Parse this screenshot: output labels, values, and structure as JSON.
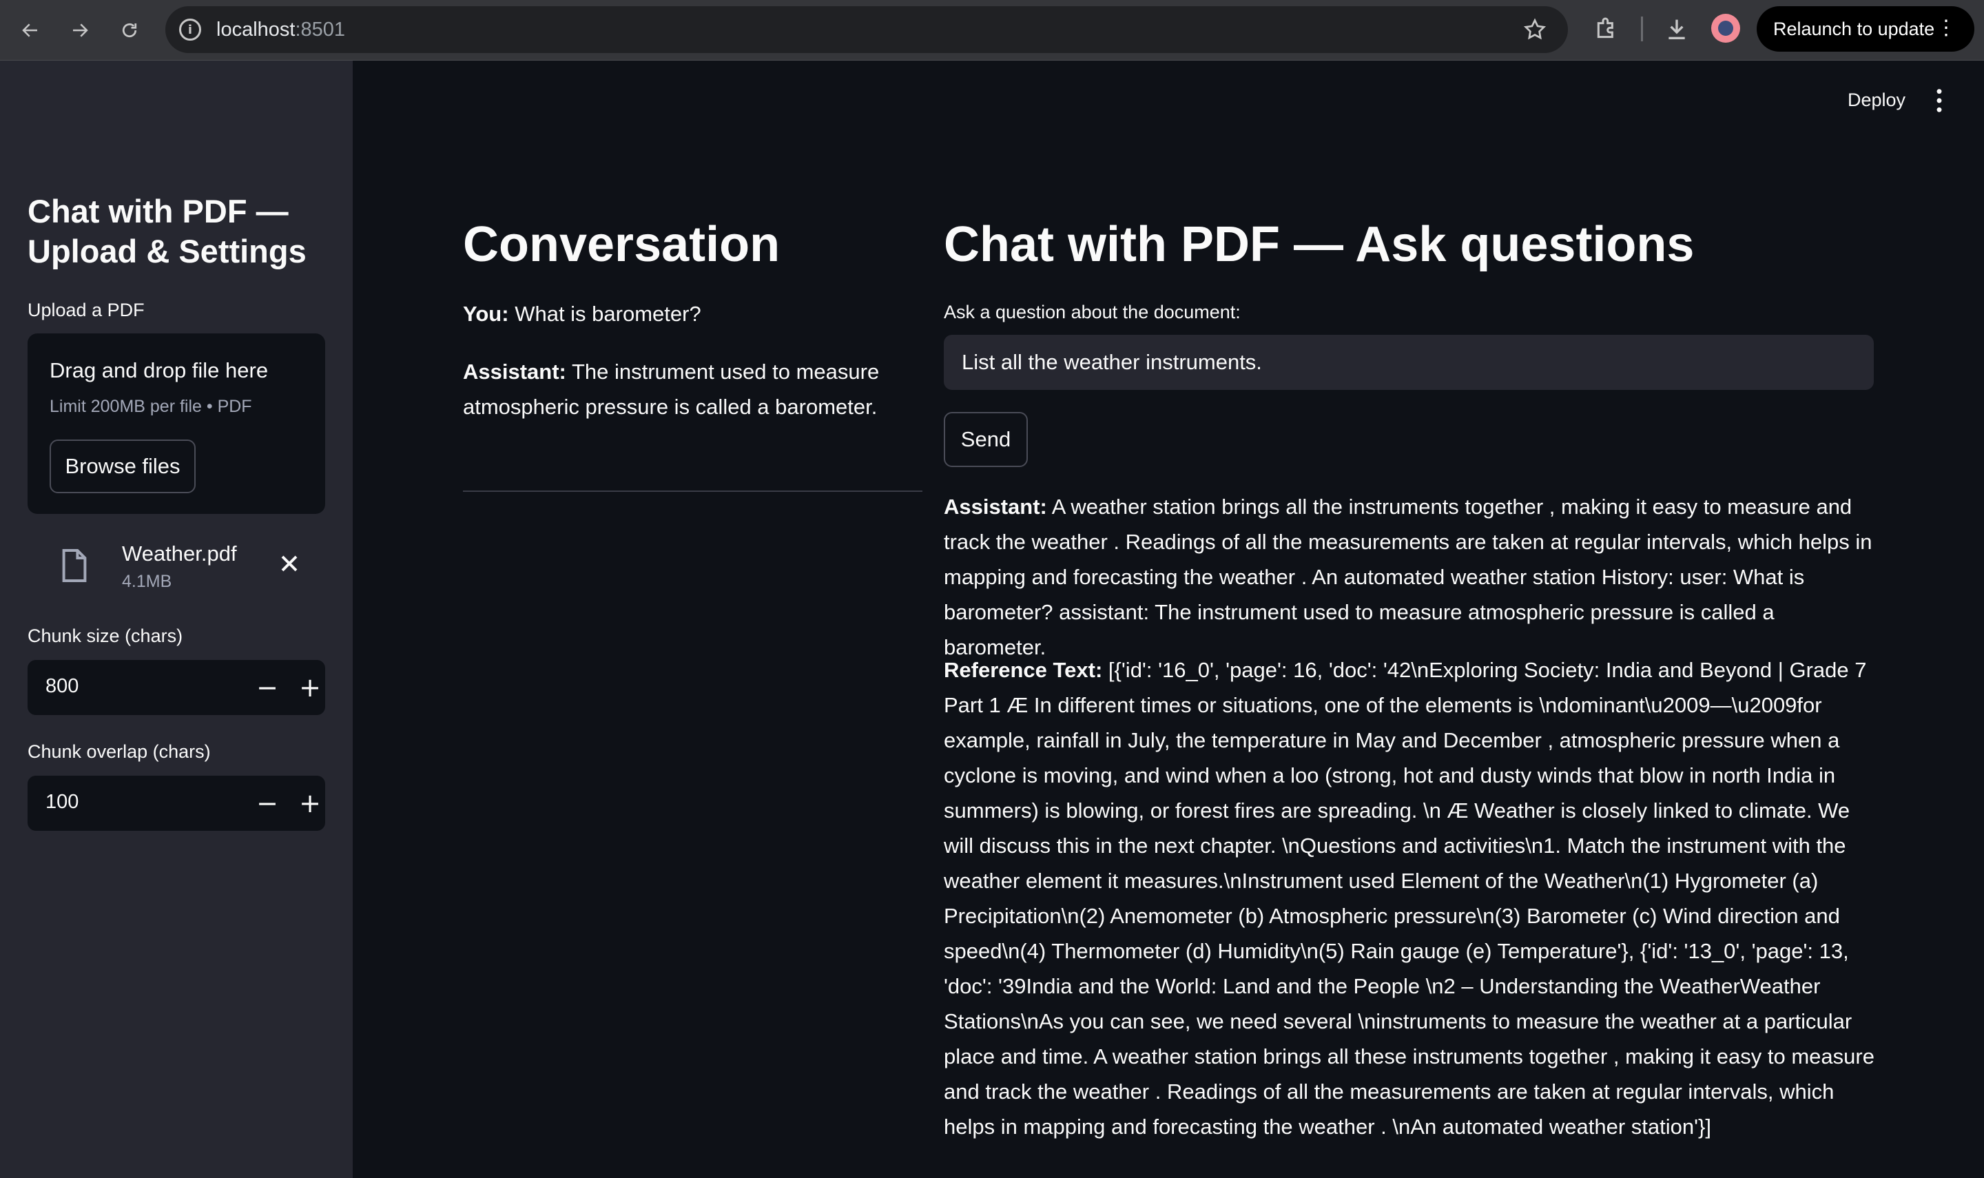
{
  "browser": {
    "url_host": "localhost",
    "url_port": ":8501",
    "relaunch_label": "Relaunch to update"
  },
  "sidebar": {
    "title": "Chat with PDF — Upload & Settings",
    "upload_label": "Upload a PDF",
    "dropzone": {
      "title": "Drag and drop file here",
      "subtitle": "Limit 200MB per file • PDF",
      "browse_label": "Browse files"
    },
    "file": {
      "name": "Weather.pdf",
      "size": "4.1MB"
    },
    "chunk_size": {
      "label": "Chunk size (chars)",
      "value": "800"
    },
    "chunk_overlap": {
      "label": "Chunk overlap (chars)",
      "value": "100"
    }
  },
  "header": {
    "deploy_label": "Deploy"
  },
  "conversation": {
    "title": "Conversation",
    "messages": [
      {
        "role": "You:",
        "text": "What is barometer?"
      },
      {
        "role": "Assistant:",
        "text": "The instrument used to measure atmospheric pressure is called a barometer."
      }
    ]
  },
  "chat": {
    "title": "Chat with PDF — Ask questions",
    "question_label": "Ask a question about the document:",
    "question_value": "List all the weather instruments.",
    "send_label": "Send",
    "answer_role": "Assistant:",
    "answer_text": "A weather station brings all the instruments together , making it easy to measure and track the weather . Readings of all the measurements are taken at regular intervals, which helps in mapping and forecasting the weather . An automated weather station History: user: What is barometer? assistant: The instrument used to measure atmospheric pressure is called a barometer.",
    "reference_role": "Reference Text:",
    "reference_text": "[{'id': '16_0', 'page': 16, 'doc': '42\\nExploring Society: India and Beyond | Grade 7 Part 1 Æ In different times or situations, one of the elements is \\ndominant\\u2009—\\u2009for example, rainfall in July, the temperature in May and December , atmospheric pressure when a cyclone is moving, and wind when a loo (strong, hot and dusty winds that blow in north India in summers) is blowing, or forest fires are spreading. \\n Æ Weather is closely linked to climate. We will discuss this in the next chapter. \\nQuestions and activities\\n1. Match the instrument with the weather element it measures.\\nInstrument used Element of the Weather\\n(1) Hygrometer (a) Precipitation\\n(2) Anemometer (b) Atmospheric pressure\\n(3) Barometer (c) Wind direction and speed\\n(4) Thermometer (d) Humidity\\n(5) Rain gauge (e) Temperature'}, {'id': '13_0', 'page': 13, 'doc': '39India and the World: Land and the People \\n2 – Understanding the WeatherWeather Stations\\nAs you can see, we need several \\ninstruments to measure the weather at a particular place and time. A weather station brings all these instruments together , making it easy to measure and track the weather . Readings of all the measurements are taken at regular intervals, which helps in mapping and forecasting the weather . \\nAn automated weather station'}]"
  }
}
